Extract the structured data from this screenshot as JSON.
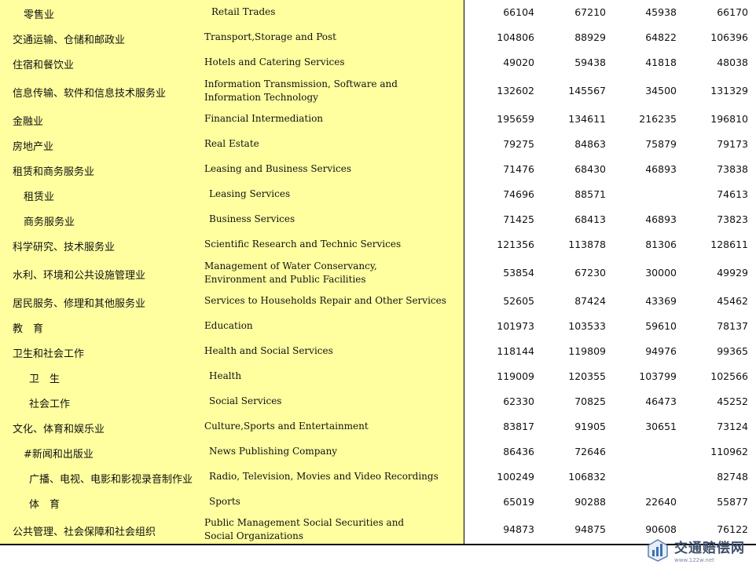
{
  "rows": [
    {
      "zh": "零售业",
      "en": "Retail Trades",
      "v1": "66104",
      "v2": "67210",
      "v3": "45938",
      "v4": "66170"
    },
    {
      "zh": "交通运输、仓储和邮政业",
      "en": "Transport,Storage and Post",
      "v1": "104806",
      "v2": "88929",
      "v3": "64822",
      "v4": "106396"
    },
    {
      "zh": "住宿和餐饮业",
      "en": "Hotels and Catering Services",
      "v1": "49020",
      "v2": "59438",
      "v3": "41818",
      "v4": "48038"
    },
    {
      "zh": "信息传输、软件和信息技术服务业",
      "en": "Information Transmission, Software and Information Technology",
      "v1": "132602",
      "v2": "145567",
      "v3": "34500",
      "v4": "131329"
    },
    {
      "zh": "金融业",
      "en": "Financial Intermediation",
      "v1": "195659",
      "v2": "134611",
      "v3": "216235",
      "v4": "196810"
    },
    {
      "zh": "房地产业",
      "en": "Real Estate",
      "v1": "79275",
      "v2": "84863",
      "v3": "75879",
      "v4": "79173"
    },
    {
      "zh": "租赁和商务服务业",
      "en": "Leasing and Business Services",
      "v1": "71476",
      "v2": "68430",
      "v3": "46893",
      "v4": "73838"
    },
    {
      "zh": "租赁业",
      "en": "Leasing Services",
      "v1": "74696",
      "v2": "88571",
      "v3": "",
      "v4": "74613"
    },
    {
      "zh": "商务服务业",
      "en": "Business Services",
      "v1": "71425",
      "v2": "68413",
      "v3": "46893",
      "v4": "73823"
    },
    {
      "zh": "科学研究、技术服务业",
      "en": "Scientific Research and Technic Services",
      "v1": "121356",
      "v2": "113878",
      "v3": "81306",
      "v4": "128611"
    },
    {
      "zh": "水利、环境和公共设施管理业",
      "en": "Management of Water Conservancy, Environment and Public Facilities",
      "v1": "53854",
      "v2": "67230",
      "v3": "30000",
      "v4": "49929"
    },
    {
      "zh": "居民服务、修理和其他服务业",
      "en": "Services to Households Repair and Other Services",
      "v1": "52605",
      "v2": "87424",
      "v3": "43369",
      "v4": "45462"
    },
    {
      "zh": "教　育",
      "en": "Education",
      "v1": "101973",
      "v2": "103533",
      "v3": "59610",
      "v4": "78137"
    },
    {
      "zh": "卫生和社会工作",
      "en": "Health and Social Services",
      "v1": "118144",
      "v2": "119809",
      "v3": "94976",
      "v4": "99365"
    },
    {
      "zh": "卫　生",
      "en": "Health",
      "v1": "119009",
      "v2": "120355",
      "v3": "103799",
      "v4": "102566"
    },
    {
      "zh": "社会工作",
      "en": "Social Services",
      "v1": "62330",
      "v2": "70825",
      "v3": "46473",
      "v4": "45252"
    },
    {
      "zh": "文化、体育和娱乐业",
      "en": "Culture,Sports and Entertainment",
      "v1": "83817",
      "v2": "91905",
      "v3": "30651",
      "v4": "73124"
    },
    {
      "zh": "#新闻和出版业",
      "en": "News Publishing Company",
      "v1": "86436",
      "v2": "72646",
      "v3": "",
      "v4": "110962"
    },
    {
      "zh": "广播、电视、电影和影视录音制作业",
      "en": "Radio, Television, Movies and Video Recordings",
      "v1": "100249",
      "v2": "106832",
      "v3": "",
      "v4": "82748"
    },
    {
      "zh": "体　育",
      "en": "Sports",
      "v1": "65019",
      "v2": "90288",
      "v3": "22640",
      "v4": "55877"
    },
    {
      "zh": "公共管理、社会保障和社会组织",
      "en": "Public Management Social Securities and Social Organizations",
      "v1": "94873",
      "v2": "94875",
      "v3": "90608",
      "v4": "76122"
    }
  ],
  "watermark": {
    "title": "交通赔偿网",
    "url": "www.122w.net",
    "icon": "watermark-logo-icon",
    "color": "#3d4f6b"
  }
}
